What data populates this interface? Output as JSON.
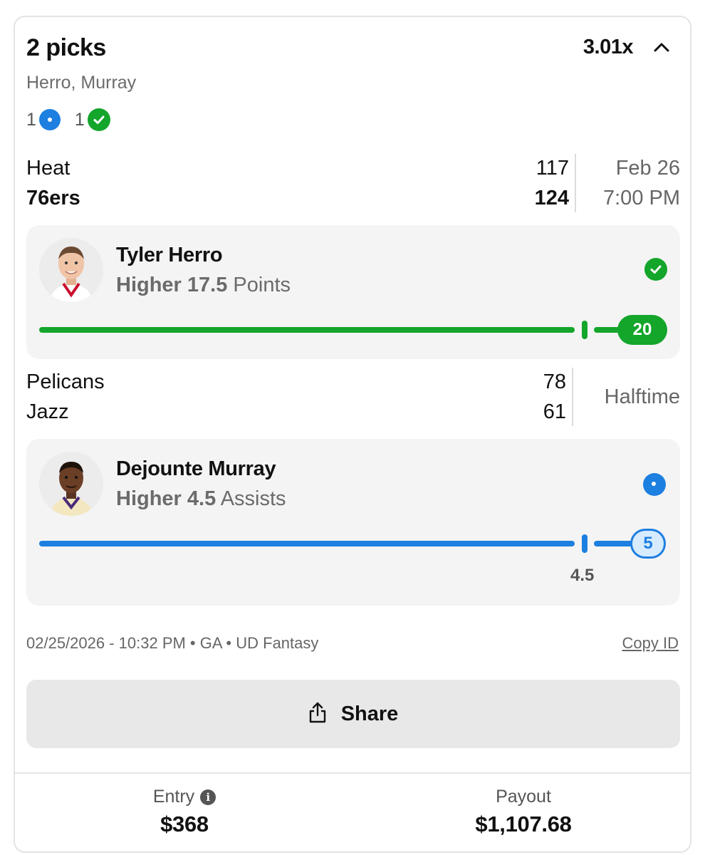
{
  "header": {
    "title": "2 picks",
    "multiplier": "3.01x",
    "subtitle": "Herro, Murray",
    "pending_count": "1",
    "won_count": "1"
  },
  "games": [
    {
      "team1": "Heat",
      "score1": "117",
      "team2": "76ers",
      "score2": "124",
      "info_line1": "Feb 26",
      "info_line2": "7:00 PM"
    },
    {
      "team1": "Pelicans",
      "score1": "78",
      "team2": "Jazz",
      "score2": "61",
      "info_line1": "Halftime"
    }
  ],
  "picks": [
    {
      "player": "Tyler Herro",
      "direction_line": "Higher 17.5",
      "stat": "Points",
      "current": "20",
      "line": 17.5,
      "status": "won",
      "color": "#14a52b"
    },
    {
      "player": "Dejounte Murray",
      "direction_line": "Higher 4.5",
      "stat": "Assists",
      "current": "5",
      "line_label": "4.5",
      "line": 4.5,
      "status": "live",
      "color": "#1d7fe0"
    }
  ],
  "meta": {
    "timestamp": "02/25/2026 - 10:32 PM • GA • UD Fantasy",
    "copy_id": "Copy ID"
  },
  "share": {
    "label": "Share"
  },
  "footer": {
    "entry_label": "Entry",
    "entry_value": "$368",
    "payout_label": "Payout",
    "payout_value": "$1,107.68"
  }
}
